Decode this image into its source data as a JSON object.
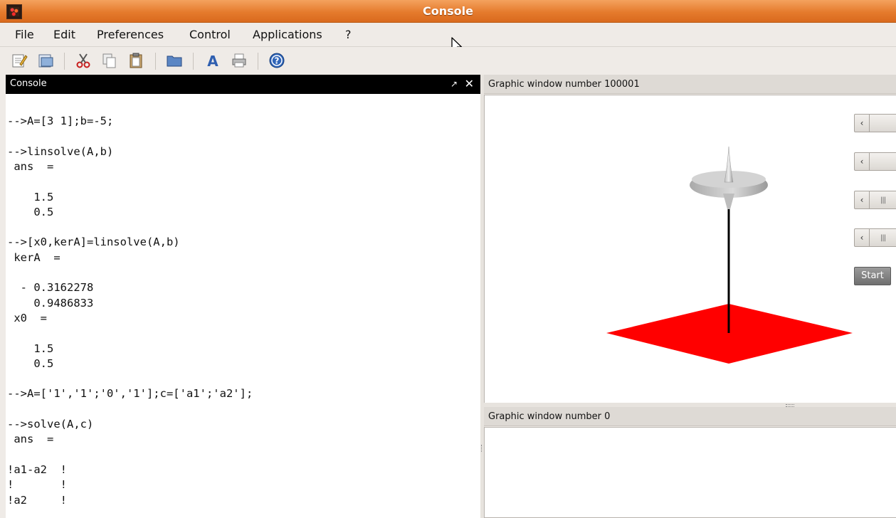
{
  "window": {
    "title": "Console"
  },
  "menu": {
    "items": [
      {
        "label": "File"
      },
      {
        "label": "Edit"
      },
      {
        "label": "Preferences"
      },
      {
        "label": "Control"
      },
      {
        "label": "Applications"
      },
      {
        "label": "?"
      }
    ]
  },
  "toolbar": {
    "buttons": [
      "new-editor-icon",
      "open-icon",
      "cut-icon",
      "copy-icon",
      "paste-icon",
      "folder-icon",
      "font-icon",
      "print-icon",
      "help-icon"
    ]
  },
  "console": {
    "title": "Console",
    "undock_glyph": "↗",
    "close_glyph": "✕",
    "lines": [
      "-->A=[3 1];b=-5;",
      "",
      "-->linsolve(A,b)",
      " ans  =",
      "",
      "    1.5",
      "    0.5",
      "",
      "-->[x0,kerA]=linsolve(A,b)",
      " kerA  =",
      "",
      "  - 0.3162278",
      "    0.9486833",
      " x0  =",
      "",
      "    1.5",
      "    0.5",
      "",
      "-->A=['1','1';'0','1'];c=['a1';'a2'];",
      "",
      "-->solve(A,c)",
      " ans  =",
      "",
      "!a1-a2  !",
      "!       !",
      "!a2     !"
    ]
  },
  "graphic1": {
    "title": "Graphic window number 100001",
    "start_label": "Start",
    "slider_left_glyph": "‹"
  },
  "graphic2": {
    "title": "Graphic window number 0"
  },
  "colors": {
    "titlebar": "#e57b2d",
    "plate": "#ff0000",
    "console_header": "#000000"
  }
}
